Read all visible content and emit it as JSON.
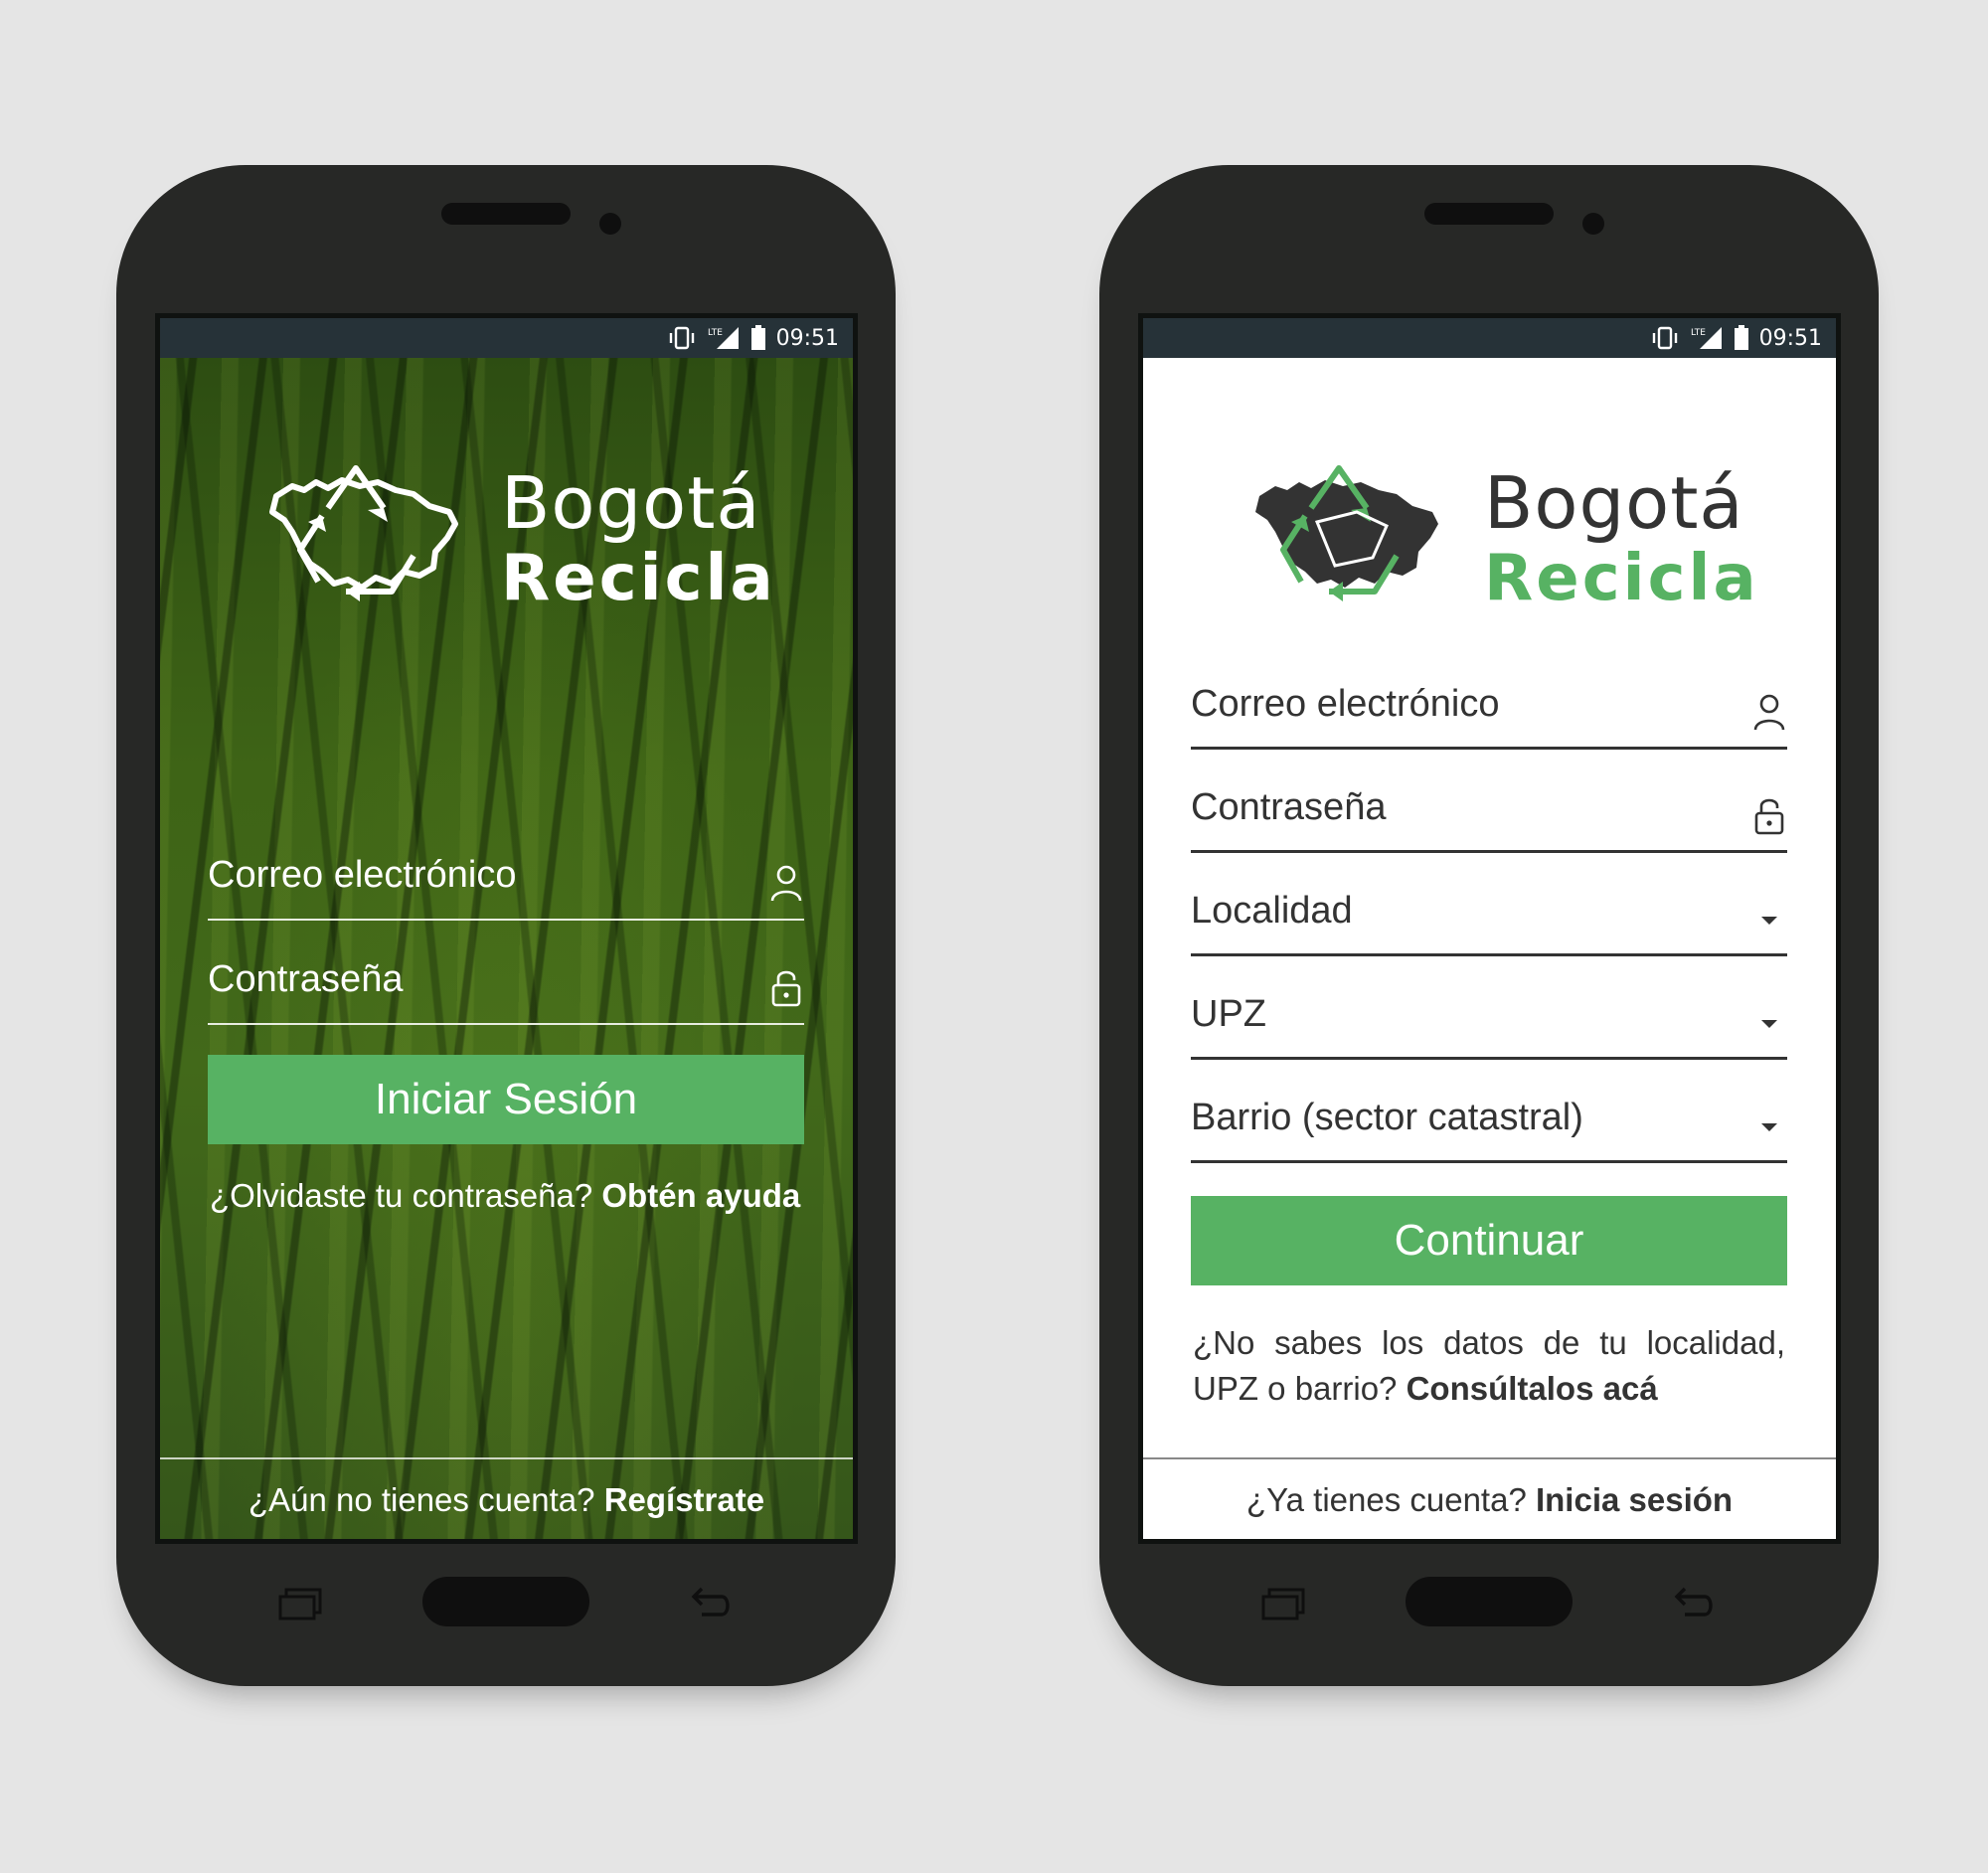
{
  "status_bar": {
    "time": "09:51",
    "network": "LTE"
  },
  "brand": {
    "line1": "Bogotá",
    "line2": "Recicla",
    "accent_color": "#57b263",
    "dark_color": "#333333"
  },
  "login_screen": {
    "email_placeholder": "Correo electrónico",
    "password_placeholder": "Contraseña",
    "email_icon": "user-icon",
    "password_icon": "lock-icon",
    "submit_label": "Iniciar Sesión",
    "help_prefix": "¿Olvidaste tu contraseña?",
    "help_link": "Obtén ayuda",
    "footer_prefix": "¿Aún no tienes cuenta?",
    "footer_link": "Regístrate"
  },
  "register_screen": {
    "email_placeholder": "Correo electrónico",
    "password_placeholder": "Contraseña",
    "locality_label": "Localidad",
    "upz_label": "UPZ",
    "barrio_label": "Barrio (sector catastral)",
    "dropdown_icon": "caret-down-icon",
    "submit_label": "Continuar",
    "help_line1": "¿No sabes los datos de tu localidad,",
    "help_line2_prefix": "UPZ o barrio?",
    "help_link": "Consúltalos acá",
    "footer_prefix": "¿Ya tienes cuenta?",
    "footer_link": "Inicia sesión"
  }
}
